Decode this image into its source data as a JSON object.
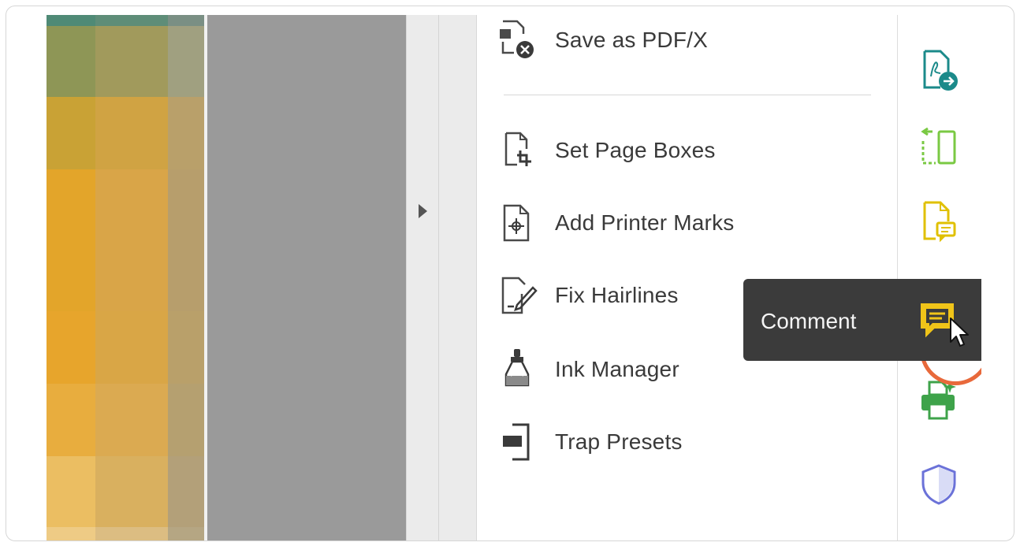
{
  "tools": {
    "save_pdfx": {
      "label": "Save as PDF/X",
      "icon": "save-pdfx-icon"
    },
    "items": [
      {
        "label": "Set Page Boxes",
        "icon": "crop-page-icon"
      },
      {
        "label": "Add Printer Marks",
        "icon": "printer-marks-icon"
      },
      {
        "label": "Fix Hairlines",
        "icon": "fix-hairlines-icon"
      },
      {
        "label": "Ink Manager",
        "icon": "ink-bottle-icon"
      },
      {
        "label": "Trap Presets",
        "icon": "trap-presets-icon"
      }
    ]
  },
  "right_bar": {
    "icons": [
      {
        "name": "export-pdf-icon",
        "color": "#1b8a8a"
      },
      {
        "name": "organize-pages-icon",
        "color": "#7ac943"
      },
      {
        "name": "comment-page-icon",
        "color": "#e0c000"
      },
      {
        "name": "comment-icon",
        "color": "#f0c419"
      },
      {
        "name": "print-production-icon",
        "color": "#3ea34a"
      },
      {
        "name": "protect-shield-icon",
        "color": "#6b72d8"
      }
    ]
  },
  "tooltip": {
    "text": "Comment"
  },
  "colors": {
    "highlight_ring": "#e8693b",
    "tooltip_bg": "#3b3b3b",
    "canvas_gray": "#9a9a9a"
  }
}
